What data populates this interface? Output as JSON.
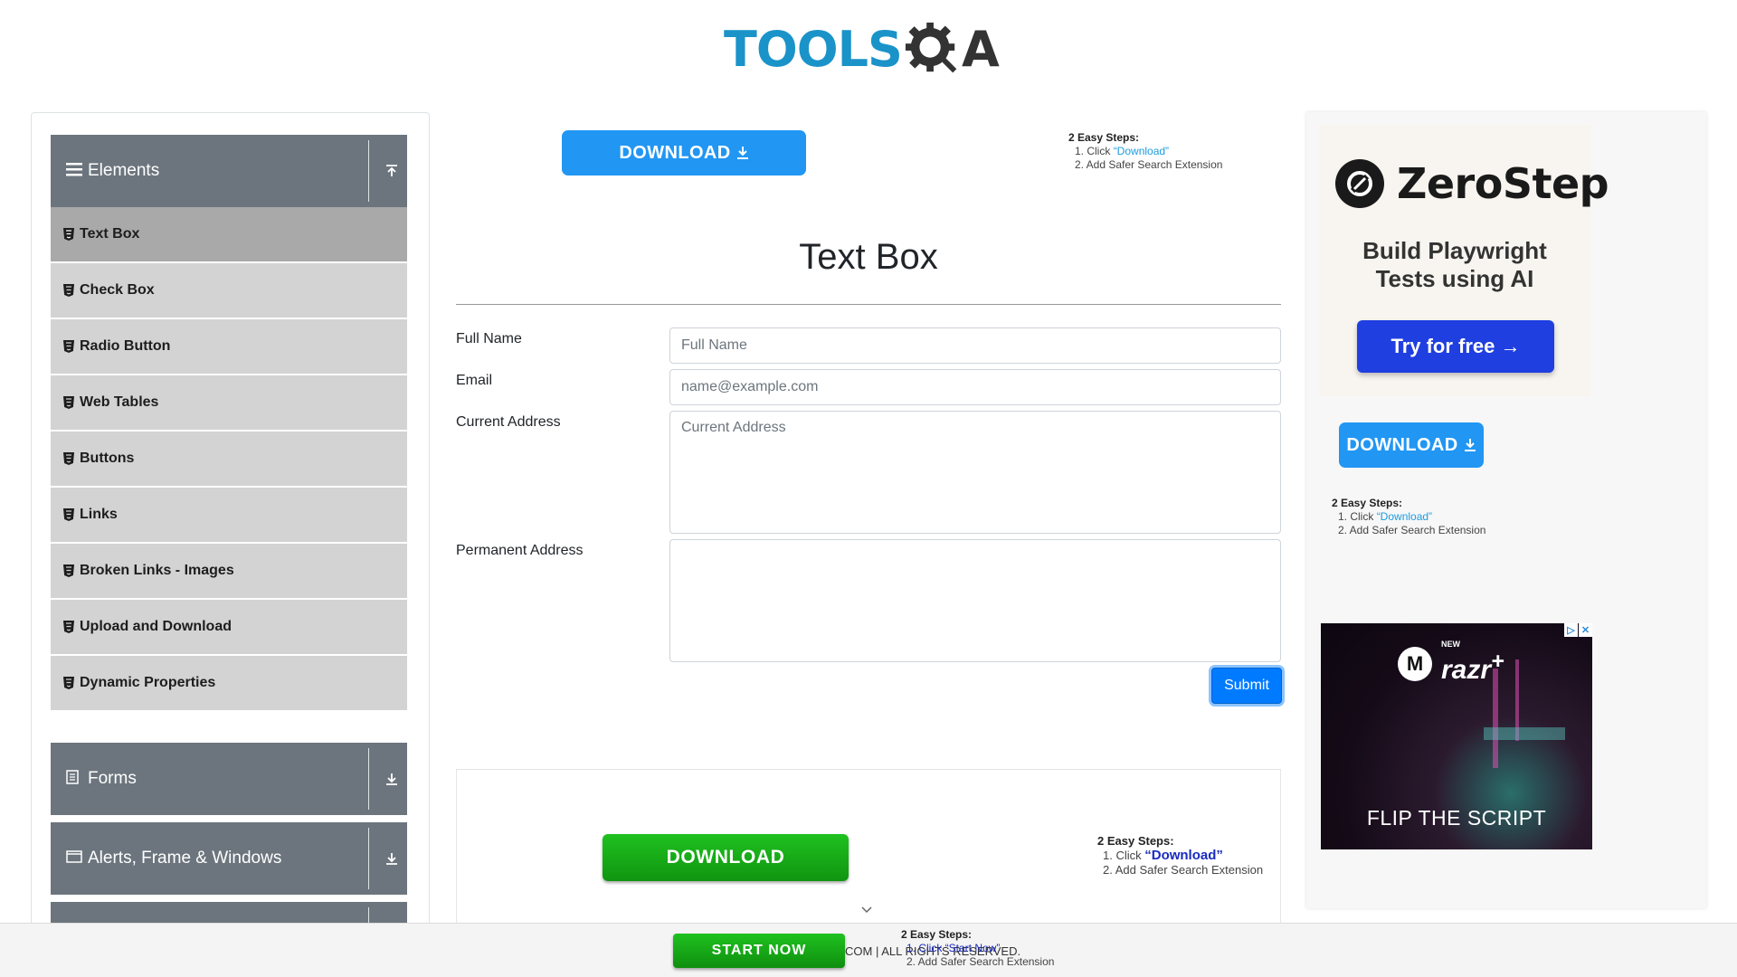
{
  "logo": {
    "text": "TOOLS",
    "suffix": "A"
  },
  "sidebar": {
    "groups": [
      {
        "label": "Elements",
        "icon": "hamburger-icon",
        "expanded": true
      },
      {
        "label": "Forms",
        "icon": "document-icon",
        "expanded": false
      },
      {
        "label": "Alerts, Frame & Windows",
        "icon": "window-icon",
        "expanded": false
      }
    ],
    "items": [
      {
        "label": "Text Box",
        "active": true
      },
      {
        "label": "Check Box"
      },
      {
        "label": "Radio Button"
      },
      {
        "label": "Web Tables"
      },
      {
        "label": "Buttons"
      },
      {
        "label": "Links"
      },
      {
        "label": "Broken Links - Images"
      },
      {
        "label": "Upload and Download"
      },
      {
        "label": "Dynamic Properties"
      }
    ]
  },
  "top_ad": {
    "button": "DOWNLOAD",
    "steps_title": "2 Easy Steps:",
    "step1_prefix": "1. Click ",
    "step1_link": "“Download”",
    "step2": "2. Add Safer Search Extension"
  },
  "page": {
    "title": "Text Box"
  },
  "form": {
    "full_name_label": "Full Name",
    "full_name_placeholder": "Full Name",
    "email_label": "Email",
    "email_placeholder": "name@example.com",
    "current_address_label": "Current Address",
    "current_address_placeholder": "Current Address",
    "permanent_address_label": "Permanent Address",
    "submit": "Submit"
  },
  "bottom_ad": {
    "button": "DOWNLOAD",
    "steps_title": "2 Easy Steps:",
    "step1_prefix": "1. Click ",
    "step1_link": "“Download”",
    "step2": "2. Add Safer Search Extension"
  },
  "right_ad": {
    "brand": "ZeroStep",
    "tagline_line1": "Build Playwright",
    "tagline_line2": "Tests using AI",
    "cta": "Try for free →",
    "download_button": "DOWNLOAD",
    "steps_title": "2 Easy Steps:",
    "step1_prefix": "1. Click ",
    "step1_link": "“Download”",
    "step2": "2. Add Safer Search Extension"
  },
  "razr_ad": {
    "new_label": "NEW",
    "name": "razr",
    "plus": "+",
    "tagline": "FLIP THE SCRIPT"
  },
  "footer": {
    "start_now": "START NOW",
    "text": "COM | ALL RIGHTS RESERVED.",
    "overlay_title": "2 Easy Steps:",
    "overlay_step1": "1. Click “Start Now”",
    "overlay_step2": "2. Add Safer Search Extension"
  },
  "colors": {
    "brand_blue": "#1a93c9",
    "download_blue": "#2196f3",
    "sidebar_header": "#6c757d",
    "submit": "#007bff",
    "green": "#1fc11f"
  }
}
